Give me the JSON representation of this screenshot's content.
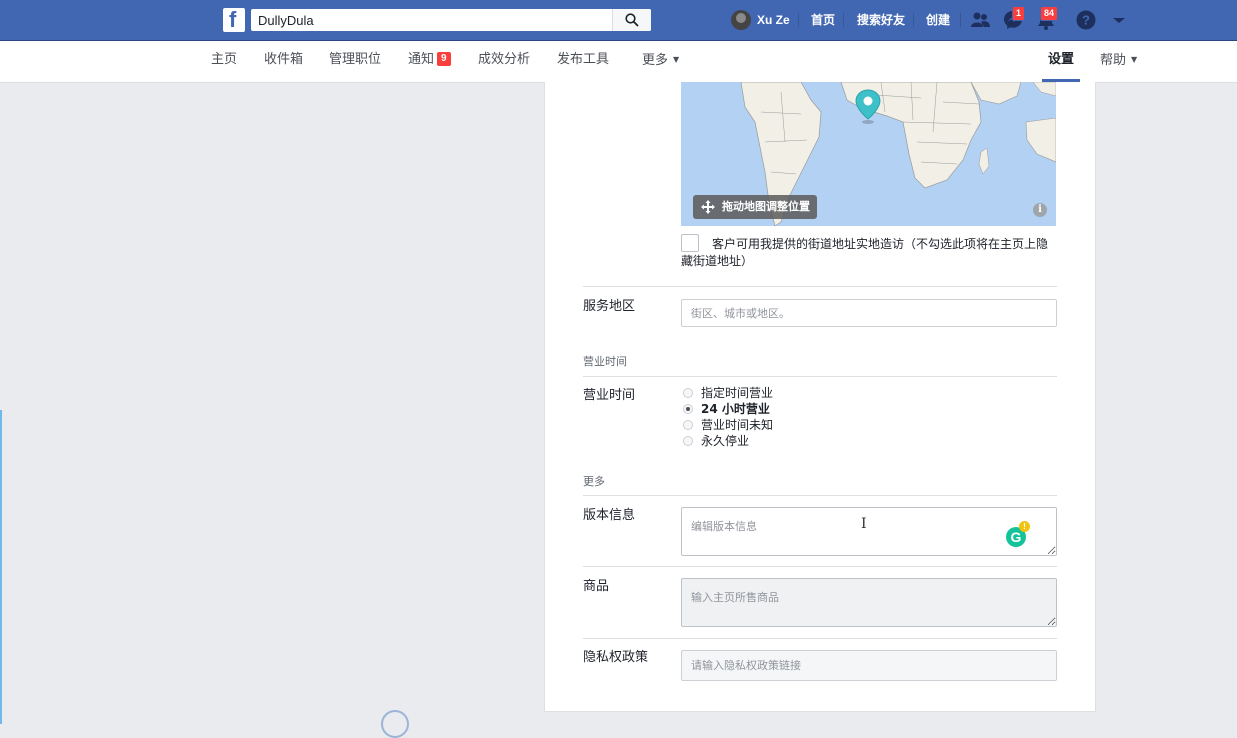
{
  "topbar": {
    "logo": "f",
    "search_value": "DullyDula",
    "user_name": "Xu Ze",
    "links": {
      "home": "首页",
      "find_friends": "搜索好友",
      "create": "创建"
    },
    "messages_badge": "1",
    "notifications_badge": "84",
    "colors": {
      "brand": "#4267b2",
      "badge": "#fa3e3e"
    }
  },
  "subnav": {
    "items": [
      {
        "label": "主页"
      },
      {
        "label": "收件箱"
      },
      {
        "label": "管理职位"
      },
      {
        "label": "通知",
        "badge": "9"
      },
      {
        "label": "成效分析"
      },
      {
        "label": "发布工具"
      },
      {
        "label": "更多",
        "caret": "▼"
      }
    ],
    "settings": "设置",
    "help": "帮助",
    "help_caret": "▼"
  },
  "map": {
    "drag_hint": "拖动地图调整位置",
    "info": "i"
  },
  "form": {
    "visit_checkbox_label": "客户可用我提供的街道地址实地造访（不勾选此项将在主页上隐藏街道地址）",
    "service_area": {
      "label": "服务地区",
      "placeholder": "街区、城市或地区。"
    },
    "hours_section": "营业时间",
    "hours": {
      "label": "营业时间",
      "options": [
        {
          "label": "指定时间营业",
          "checked": false
        },
        {
          "label": "24 小时营业",
          "checked": true
        },
        {
          "label": "营业时间未知",
          "checked": false
        },
        {
          "label": "永久停业",
          "checked": false
        }
      ]
    },
    "more_section": "更多",
    "impressum": {
      "label": "版本信息",
      "placeholder": "编辑版本信息"
    },
    "products": {
      "label": "商品",
      "placeholder": "输入主页所售商品"
    },
    "privacy": {
      "label": "隐私权政策",
      "placeholder": "请输入隐私权政策链接"
    }
  },
  "grammarly": {
    "letter": "G",
    "alert": "!"
  }
}
